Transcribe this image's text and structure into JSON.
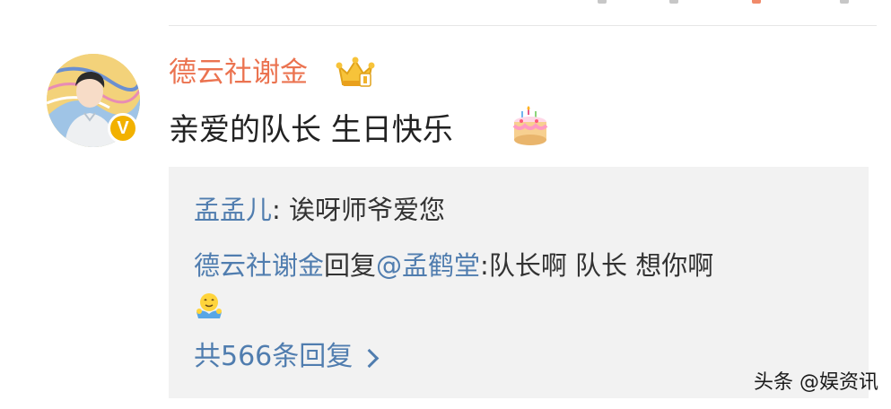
{
  "post": {
    "username": "德云社谢金",
    "text": "亲爱的队长 生日快乐",
    "verified_badge": "V"
  },
  "replies": {
    "reply1_user": "孟孟儿",
    "reply1_separator": ": ",
    "reply1_text": "诶呀师爷爱您",
    "reply2_user": "德云社谢金",
    "reply2_verb": "回复",
    "reply2_mention": "@孟鹤堂",
    "reply2_text": ":队长啊 队长 想你啊",
    "more_replies_label": "共566条回复"
  },
  "watermark": "头条 @娱资讯",
  "icons": {
    "crown": "crown-icon",
    "cake": "birthday-cake-icon",
    "hug": "hug-emoji-icon",
    "chevron": "chevron-right-icon"
  },
  "colors": {
    "username": "#eb7350",
    "link": "#507daf",
    "reply_bg": "#f2f2f2",
    "badge": "#f2b100"
  }
}
